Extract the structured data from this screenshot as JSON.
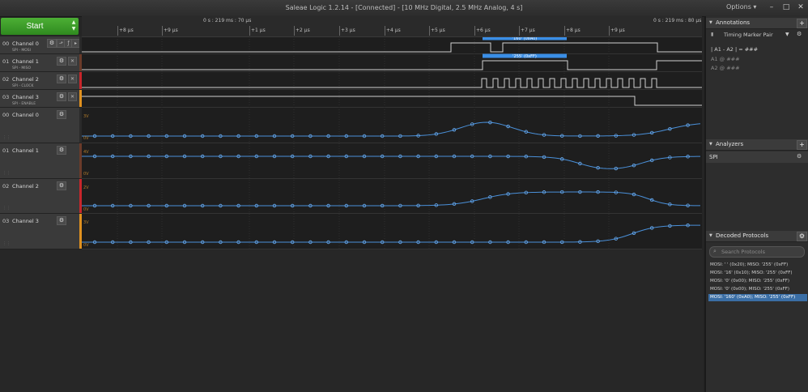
{
  "window": {
    "title": "Saleae Logic 1.2.14 - [Connected] - [10 MHz Digital, 2.5 MHz Analog, 4 s]",
    "options_label": "Options ▾",
    "controls": [
      "–",
      "□",
      "✕"
    ]
  },
  "start_button": {
    "label": "Start"
  },
  "timeline": {
    "center_label": "0 s : 219 ms : 70 μs",
    "right_label": "0 s : 219 ms : 80 μs",
    "ticks": [
      "+8 μs",
      "+9 μs",
      "+1 μs",
      "+2 μs",
      "+3 μs",
      "+4 μs",
      "+5 μs",
      "+6 μs",
      "+7 μs",
      "+8 μs",
      "+9 μs"
    ]
  },
  "digital_channels": [
    {
      "num": "00",
      "name": "Channel 0",
      "sub": "SPI - MOSI",
      "color": "#555555"
    },
    {
      "num": "01",
      "name": "Channel 1",
      "sub": "SPI - MISO",
      "color": "#6b3b2a"
    },
    {
      "num": "02",
      "name": "Channel 2",
      "sub": "SPI - CLOCK",
      "color": "#c8262b"
    },
    {
      "num": "03",
      "name": "Channel 3",
      "sub": "SPI - ENABLE",
      "color": "#e0911f"
    }
  ],
  "analog_channels": [
    {
      "num": "00",
      "name": "Channel 0",
      "color": "#555555",
      "top_label": "3V",
      "bottom_label": "0V"
    },
    {
      "num": "01",
      "name": "Channel 1",
      "color": "#6b3b2a",
      "top_label": "4V",
      "bottom_label": "0V"
    },
    {
      "num": "02",
      "name": "Channel 2",
      "color": "#c8262b",
      "top_label": "2V",
      "bottom_label": "0V"
    },
    {
      "num": "03",
      "name": "Channel 3",
      "color": "#e0911f",
      "top_label": "3V",
      "bottom_label": "0V"
    }
  ],
  "decode_bubbles": {
    "mosi": "'160' (0xA0)",
    "miso": "'255' (0xFF)"
  },
  "annotations": {
    "header": "Annotations",
    "timing_pair": "Timing Marker Pair",
    "formula": "| A1 - A2 | = ###",
    "a1": "A1 @ ###",
    "a2": "A2 @ ###"
  },
  "analyzers": {
    "header": "Analyzers",
    "items": [
      "SPI"
    ]
  },
  "decoded": {
    "header": "Decoded Protocols",
    "search_placeholder": "Search Protocols",
    "rows": [
      "MOSI: ' ' (0x20);  MISO: '255' (0xFF)",
      "MOSI: '16' (0x10);  MISO: '255' (0xFF)",
      "MOSI: '0' (0x00);  MISO: '255' (0xFF)",
      "MOSI: '0' (0x00);  MISO: '255' (0xFF)",
      "MOSI: '160' (0xA0);  MISO: '255' (0xFF)"
    ]
  },
  "colors": {
    "accent": "#3a8ee6",
    "start_green": "#3fa02a",
    "selection": "#3a6ea5"
  }
}
